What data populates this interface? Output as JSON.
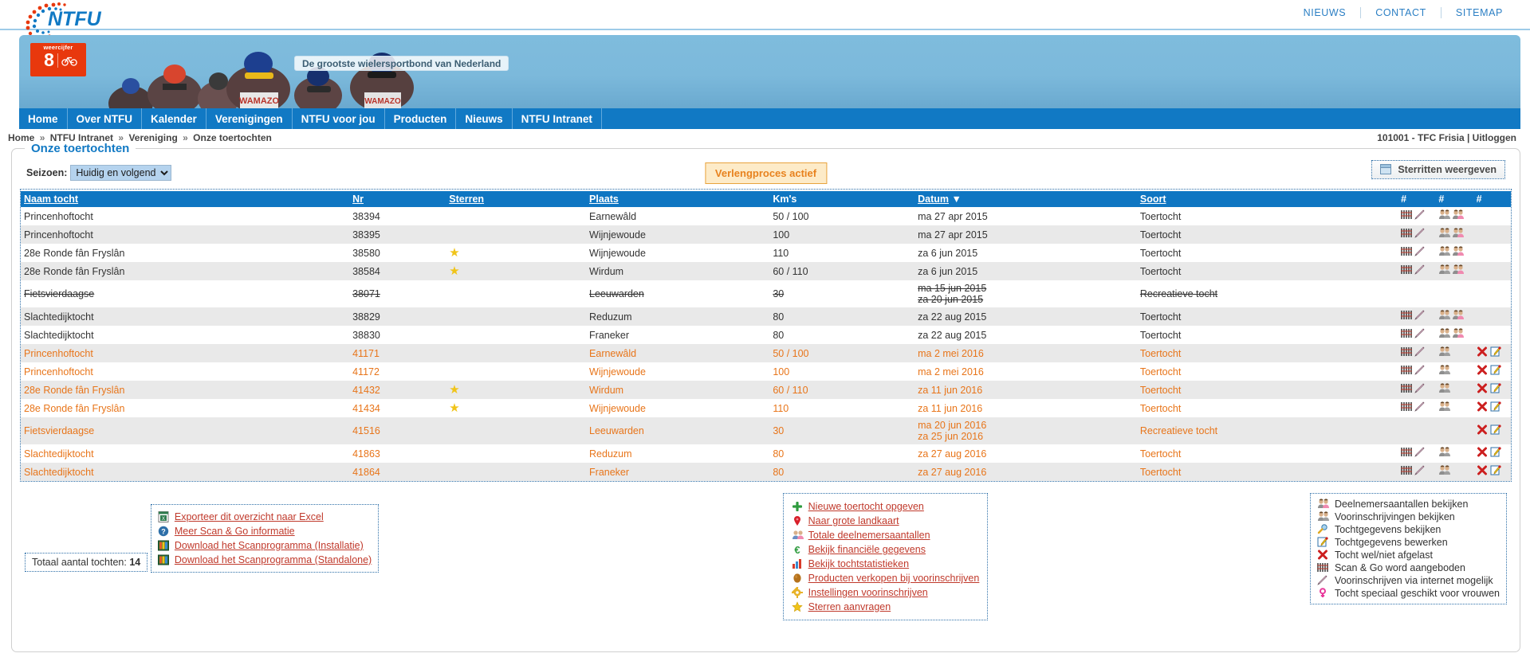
{
  "top": {
    "logo_text": "NTFU",
    "links": [
      "NIEUWS",
      "CONTACT",
      "SITEMAP"
    ]
  },
  "banner": {
    "weercijfer_label": "weercijfer",
    "weercijfer_value": "8",
    "slogan": "De grootste wielersportbond van Nederland"
  },
  "nav": {
    "items": [
      "Home",
      "Over NTFU",
      "Kalender",
      "Verenigingen",
      "NTFU voor jou",
      "Producten",
      "Nieuws",
      "NTFU Intranet"
    ]
  },
  "breadcrumb": {
    "parts": [
      "Home",
      "NTFU Intranet",
      "Vereniging",
      "Onze toertochten"
    ],
    "separator": "»"
  },
  "account": {
    "name": "101001 - TFC Frisia",
    "separator": "|",
    "logout": "Uitloggen"
  },
  "page": {
    "title": "Onze toertochten"
  },
  "toolbar": {
    "season_label": "Seizoen:",
    "season_value": "Huidig en volgend",
    "season_options": [
      "Huidig en volgend"
    ],
    "badge": "Verlengproces actief",
    "sterritten_button": "Sterritten weergeven"
  },
  "table": {
    "headers": {
      "naam": "Naam tocht",
      "nr": "Nr",
      "sterren": "Sterren",
      "plaats": "Plaats",
      "km": "Km's",
      "datum": "Datum",
      "datum_sort": "▼",
      "soort": "Soort",
      "hash1": "#",
      "hash2": "#",
      "hash3": "#"
    },
    "rows": [
      {
        "naam": "Princenhoftocht",
        "nr": "38394",
        "ster": "",
        "plaats": "Earnewâld",
        "km": "50 / 100",
        "datum": "ma 27 apr 2015",
        "datum2": "",
        "soort": "Toertocht",
        "scan": true,
        "pen": true,
        "deeln": true,
        "voor": true,
        "cancel": false,
        "edit": false,
        "year": 2015,
        "strike": false
      },
      {
        "naam": "Princenhoftocht",
        "nr": "38395",
        "ster": "",
        "plaats": "Wijnjewoude",
        "km": "100",
        "datum": "ma 27 apr 2015",
        "datum2": "",
        "soort": "Toertocht",
        "scan": true,
        "pen": true,
        "deeln": true,
        "voor": true,
        "cancel": false,
        "edit": false,
        "year": 2015,
        "strike": false
      },
      {
        "naam": "28e Ronde fân Fryslân",
        "nr": "38580",
        "ster": "★",
        "plaats": "Wijnjewoude",
        "km": "110",
        "datum": "za 6 jun 2015",
        "datum2": "",
        "soort": "Toertocht",
        "scan": true,
        "pen": true,
        "deeln": true,
        "voor": true,
        "cancel": false,
        "edit": false,
        "year": 2015,
        "strike": false
      },
      {
        "naam": "28e Ronde fân Fryslân",
        "nr": "38584",
        "ster": "★",
        "plaats": "Wirdum",
        "km": "60 / 110",
        "datum": "za 6 jun 2015",
        "datum2": "",
        "soort": "Toertocht",
        "scan": true,
        "pen": true,
        "deeln": true,
        "voor": true,
        "cancel": false,
        "edit": false,
        "year": 2015,
        "strike": false
      },
      {
        "naam": "Fietsvierdaagse",
        "nr": "38071",
        "ster": "",
        "plaats": "Leeuwarden",
        "km": "30",
        "datum": "ma 15 jun 2015",
        "datum2": "za 20 jun 2015",
        "soort": "Recreatieve tocht",
        "scan": false,
        "pen": false,
        "deeln": false,
        "voor": false,
        "cancel": false,
        "edit": false,
        "year": 2015,
        "strike": true
      },
      {
        "naam": "Slachtedijktocht",
        "nr": "38829",
        "ster": "",
        "plaats": "Reduzum",
        "km": "80",
        "datum": "za 22 aug 2015",
        "datum2": "",
        "soort": "Toertocht",
        "scan": true,
        "pen": true,
        "deeln": true,
        "voor": true,
        "cancel": false,
        "edit": false,
        "year": 2015,
        "strike": false
      },
      {
        "naam": "Slachtedijktocht",
        "nr": "38830",
        "ster": "",
        "plaats": "Franeker",
        "km": "80",
        "datum": "za 22 aug 2015",
        "datum2": "",
        "soort": "Toertocht",
        "scan": true,
        "pen": true,
        "deeln": true,
        "voor": true,
        "cancel": false,
        "edit": false,
        "year": 2015,
        "strike": false
      },
      {
        "naam": "Princenhoftocht",
        "nr": "41171",
        "ster": "",
        "plaats": "Earnewâld",
        "km": "50 / 100",
        "datum": "ma 2 mei 2016",
        "datum2": "",
        "soort": "Toertocht",
        "scan": true,
        "pen": true,
        "deeln": true,
        "voor": false,
        "cancel": true,
        "edit": true,
        "year": 2016,
        "strike": false
      },
      {
        "naam": "Princenhoftocht",
        "nr": "41172",
        "ster": "",
        "plaats": "Wijnjewoude",
        "km": "100",
        "datum": "ma 2 mei 2016",
        "datum2": "",
        "soort": "Toertocht",
        "scan": true,
        "pen": true,
        "deeln": true,
        "voor": false,
        "cancel": true,
        "edit": true,
        "year": 2016,
        "strike": false
      },
      {
        "naam": "28e Ronde fân Fryslân",
        "nr": "41432",
        "ster": "★",
        "plaats": "Wirdum",
        "km": "60 / 110",
        "datum": "za 11 jun 2016",
        "datum2": "",
        "soort": "Toertocht",
        "scan": true,
        "pen": true,
        "deeln": true,
        "voor": false,
        "cancel": true,
        "edit": true,
        "year": 2016,
        "strike": false
      },
      {
        "naam": "28e Ronde fân Fryslân",
        "nr": "41434",
        "ster": "★",
        "plaats": "Wijnjewoude",
        "km": "110",
        "datum": "za 11 jun 2016",
        "datum2": "",
        "soort": "Toertocht",
        "scan": true,
        "pen": true,
        "deeln": true,
        "voor": false,
        "cancel": true,
        "edit": true,
        "year": 2016,
        "strike": false
      },
      {
        "naam": "Fietsvierdaagse",
        "nr": "41516",
        "ster": "",
        "plaats": "Leeuwarden",
        "km": "30",
        "datum": "ma 20 jun 2016",
        "datum2": "za 25 jun 2016",
        "soort": "Recreatieve tocht",
        "scan": false,
        "pen": false,
        "deeln": false,
        "voor": false,
        "cancel": true,
        "edit": true,
        "year": 2016,
        "strike": false
      },
      {
        "naam": "Slachtedijktocht",
        "nr": "41863",
        "ster": "",
        "plaats": "Reduzum",
        "km": "80",
        "datum": "za 27 aug 2016",
        "datum2": "",
        "soort": "Toertocht",
        "scan": true,
        "pen": true,
        "deeln": true,
        "voor": false,
        "cancel": true,
        "edit": true,
        "year": 2016,
        "strike": false
      },
      {
        "naam": "Slachtedijktocht",
        "nr": "41864",
        "ster": "",
        "plaats": "Franeker",
        "km": "80",
        "datum": "za 27 aug 2016",
        "datum2": "",
        "soort": "Toertocht",
        "scan": true,
        "pen": true,
        "deeln": true,
        "voor": false,
        "cancel": true,
        "edit": true,
        "year": 2016,
        "strike": false
      }
    ]
  },
  "footer": {
    "total_label": "Totaal aantal tochten:",
    "total_value": "14",
    "export_links": [
      {
        "icon": "excel-icon",
        "label": "Exporteer dit overzicht naar Excel"
      },
      {
        "icon": "help-icon",
        "label": "Meer Scan & Go informatie"
      },
      {
        "icon": "download-icon",
        "label": "Download het Scanprogramma (Installatie)"
      },
      {
        "icon": "download-icon",
        "label": "Download het Scanprogramma (Standalone)"
      }
    ],
    "action_links": [
      {
        "icon": "plus-icon",
        "label": "Nieuwe toertocht opgeven"
      },
      {
        "icon": "map-pin-icon",
        "label": "Naar grote landkaart"
      },
      {
        "icon": "people-icon",
        "label": "Totale deelnemersaantallen"
      },
      {
        "icon": "euro-icon",
        "label": "Bekijk financiële gegevens"
      },
      {
        "icon": "bar-chart-icon",
        "label": "Bekijk tochtstatistieken"
      },
      {
        "icon": "product-icon",
        "label": "Producten verkopen bij voorinschrijven"
      },
      {
        "icon": "settings-icon",
        "label": "Instellingen voorinschrijven"
      },
      {
        "icon": "star-icon",
        "label": "Sterren aanvragen"
      }
    ],
    "legend": [
      {
        "icon": "people-pink-icon",
        "label": "Deelnemersaantallen bekijken"
      },
      {
        "icon": "people-grey-icon",
        "label": "Voorinschrijvingen bekijken"
      },
      {
        "icon": "magnifier-icon",
        "label": "Tochtgegevens bekijken"
      },
      {
        "icon": "edit-note-icon",
        "label": "Tochtgegevens bewerken"
      },
      {
        "icon": "red-x-icon",
        "label": "Tocht wel/niet afgelast"
      },
      {
        "icon": "barcode-icon",
        "label": "Scan & Go word aangeboden"
      },
      {
        "icon": "pencil-icon",
        "label": "Voorinschrijven via internet mogelijk"
      },
      {
        "icon": "venus-icon",
        "label": "Tocht speciaal geschikt voor vrouwen"
      }
    ]
  },
  "colors": {
    "brand_blue": "#1179c4",
    "link_red": "#c0392b",
    "year_2016": "#e8751a",
    "badge_orange": "#e8821e"
  }
}
